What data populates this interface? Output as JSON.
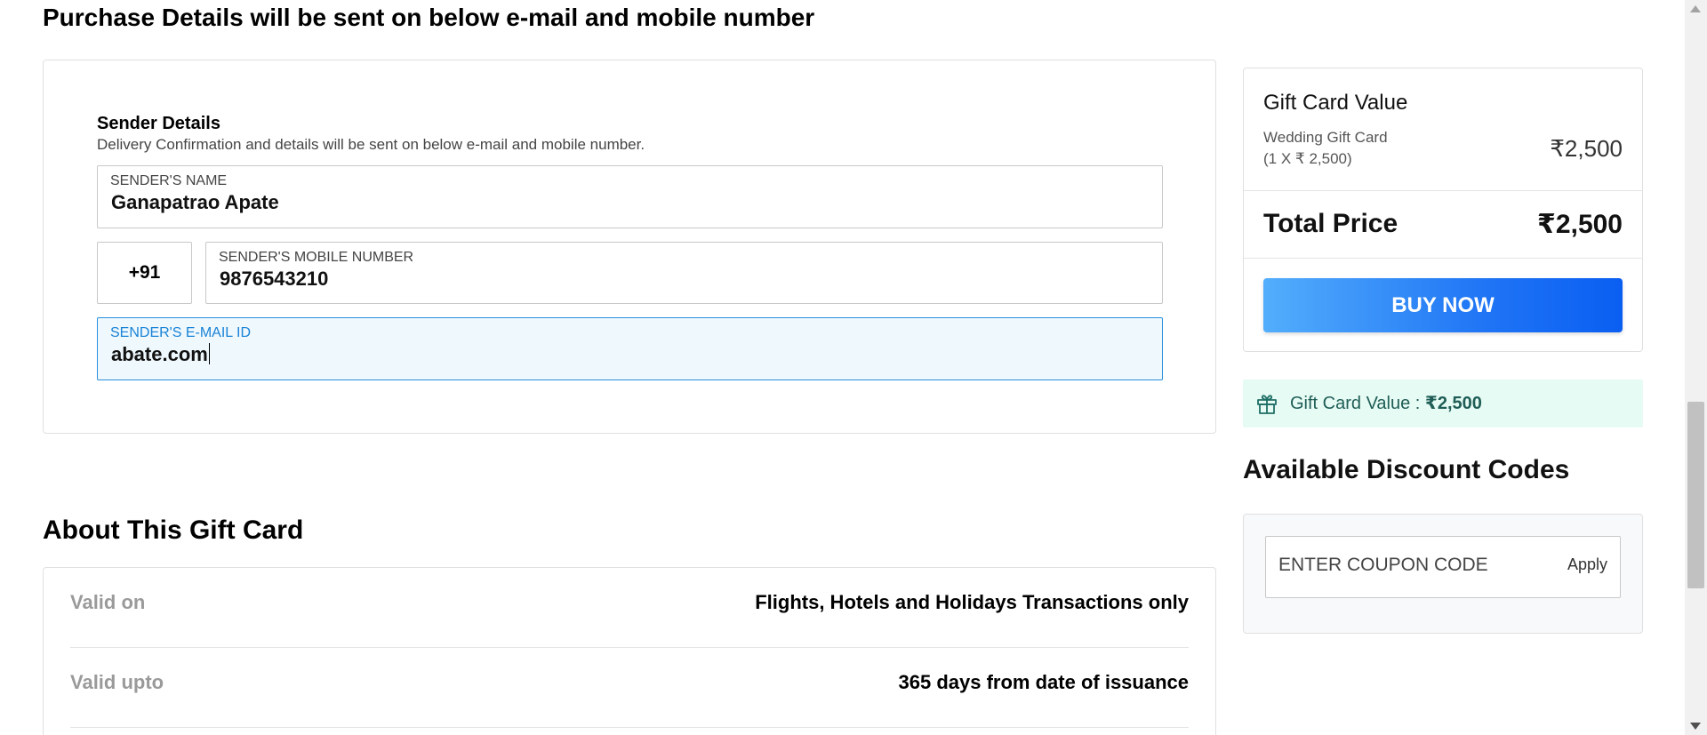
{
  "purchase_heading": "Purchase Details will be sent on below e-mail and mobile number",
  "sender": {
    "title": "Sender Details",
    "subtitle": "Delivery Confirmation and details will be sent on below e-mail and mobile number.",
    "name_label": "SENDER'S NAME",
    "name_value": "Ganapatrao Apate",
    "country_code": "+91",
    "mobile_label": "SENDER'S MOBILE NUMBER",
    "mobile_value": "9876543210",
    "email_label": "SENDER'S E-MAIL ID",
    "email_value": "abate.com"
  },
  "about": {
    "heading": "About This Gift Card",
    "rows": [
      {
        "key": "Valid on",
        "value": "Flights, Hotels and Holidays Transactions only"
      },
      {
        "key": "Valid upto",
        "value": "365 days from date of issuance"
      }
    ]
  },
  "summary": {
    "title": "Gift Card Value",
    "card_name": "Wedding Gift Card",
    "card_qty": "(1 X ₹ 2,500)",
    "card_amount": "₹2,500",
    "total_label": "Total Price",
    "total_value": "₹2,500",
    "buy_label": "BUY NOW"
  },
  "banner": {
    "label": "Gift Card Value : ",
    "value": "₹2,500",
    "icon": "gift-icon"
  },
  "discount": {
    "heading": "Available Discount Codes",
    "placeholder": "ENTER COUPON CODE",
    "apply_label": "Apply"
  },
  "colors": {
    "accent_blue": "#1a83d6",
    "buy_gradient_start": "#53aefc",
    "buy_gradient_end": "#0a5ef2",
    "banner_bg": "#e6fbf3",
    "banner_text": "#1f5e57"
  }
}
